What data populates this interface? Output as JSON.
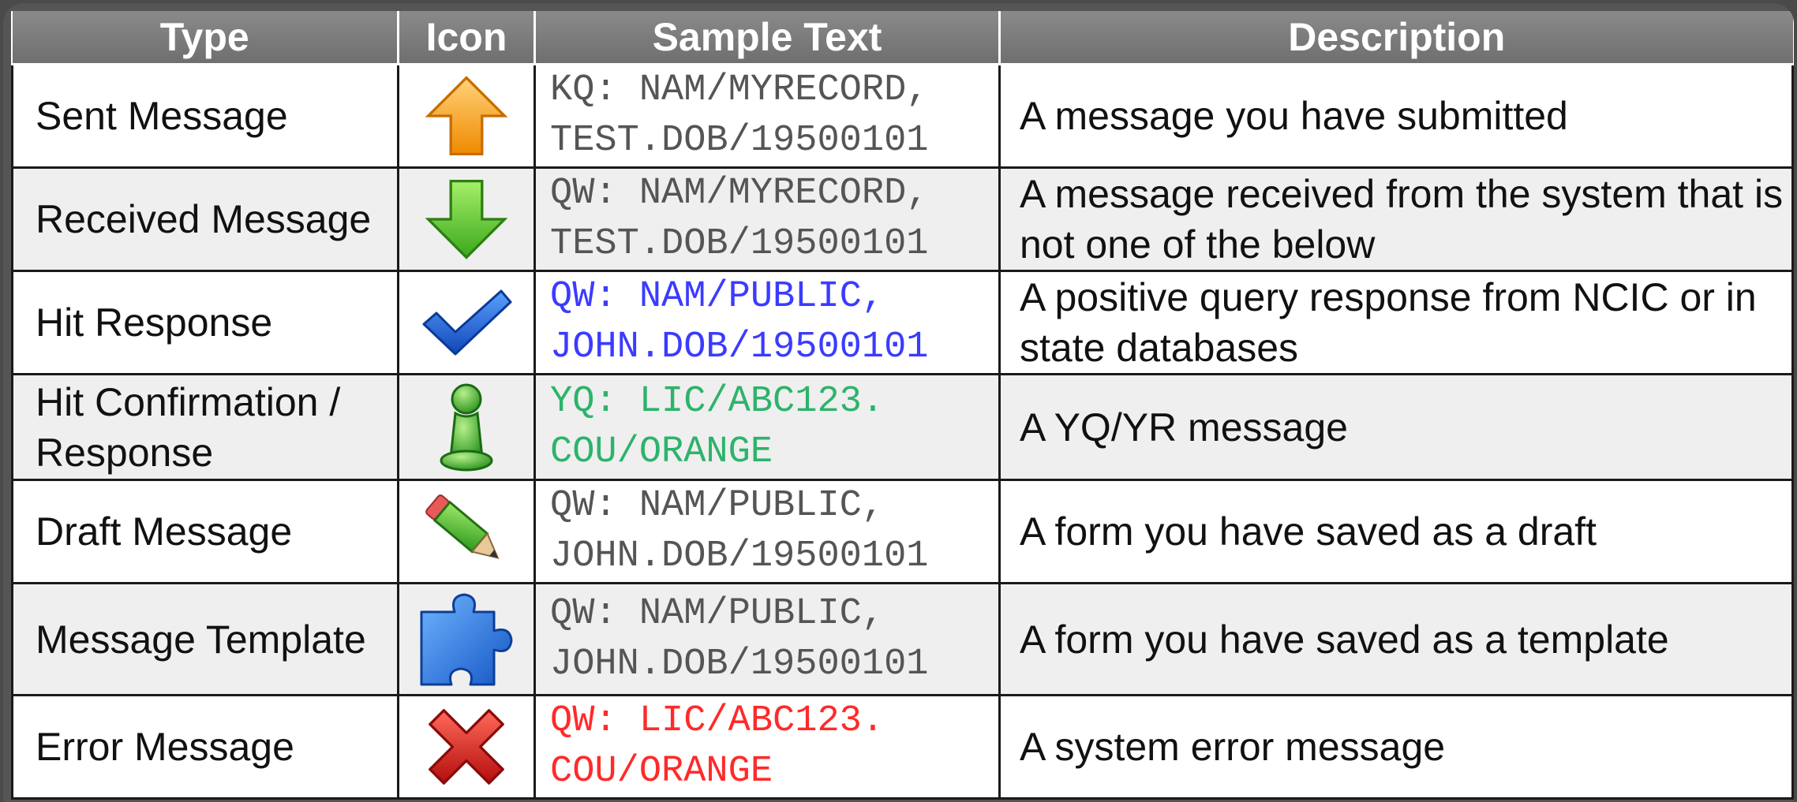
{
  "table": {
    "headers": {
      "type": "Type",
      "icon": "Icon",
      "sample": "Sample Text",
      "description": "Description"
    },
    "rows": [
      {
        "type": "Sent Message",
        "icon": "up-arrow-icon",
        "sample_line1": "KQ: NAM/MYRECORD,",
        "sample_line2": "TEST.DOB/19500101",
        "sample_color": "#555555",
        "description": "A message you have submitted"
      },
      {
        "type": "Received Message",
        "icon": "down-arrow-icon",
        "sample_line1": "QW: NAM/MYRECORD,",
        "sample_line2": "TEST.DOB/19500101",
        "sample_color": "#555555",
        "description": "A message received from the system that is not one of the below"
      },
      {
        "type": "Hit Response",
        "icon": "checkmark-icon",
        "sample_line1": "QW: NAM/PUBLIC,",
        "sample_line2": "JOHN.DOB/19500101",
        "sample_color": "#3b3bff",
        "description": "A positive query response from NCIC or in state databases"
      },
      {
        "type": "Hit Confirmation / Response",
        "icon": "pawn-icon",
        "sample_line1": "YQ: LIC/ABC123.",
        "sample_line2": "COU/ORANGE",
        "sample_color": "#2db36b",
        "description": "A YQ/YR message"
      },
      {
        "type": "Draft Message",
        "icon": "pencil-icon",
        "sample_line1": "QW: NAM/PUBLIC,",
        "sample_line2": "JOHN.DOB/19500101",
        "sample_color": "#555555",
        "description": "A form you have saved as a draft"
      },
      {
        "type": "Message Template",
        "icon": "puzzle-icon",
        "sample_line1": "QW: NAM/PUBLIC,",
        "sample_line2": "JOHN.DOB/19500101",
        "sample_color": "#555555",
        "description": "A form you have saved as a template"
      },
      {
        "type": "Error Message",
        "icon": "error-x-icon",
        "sample_line1": "QW: LIC/ABC123.",
        "sample_line2": "COU/ORANGE",
        "sample_color": "#ff2a2a",
        "description": "A system error message"
      }
    ]
  }
}
